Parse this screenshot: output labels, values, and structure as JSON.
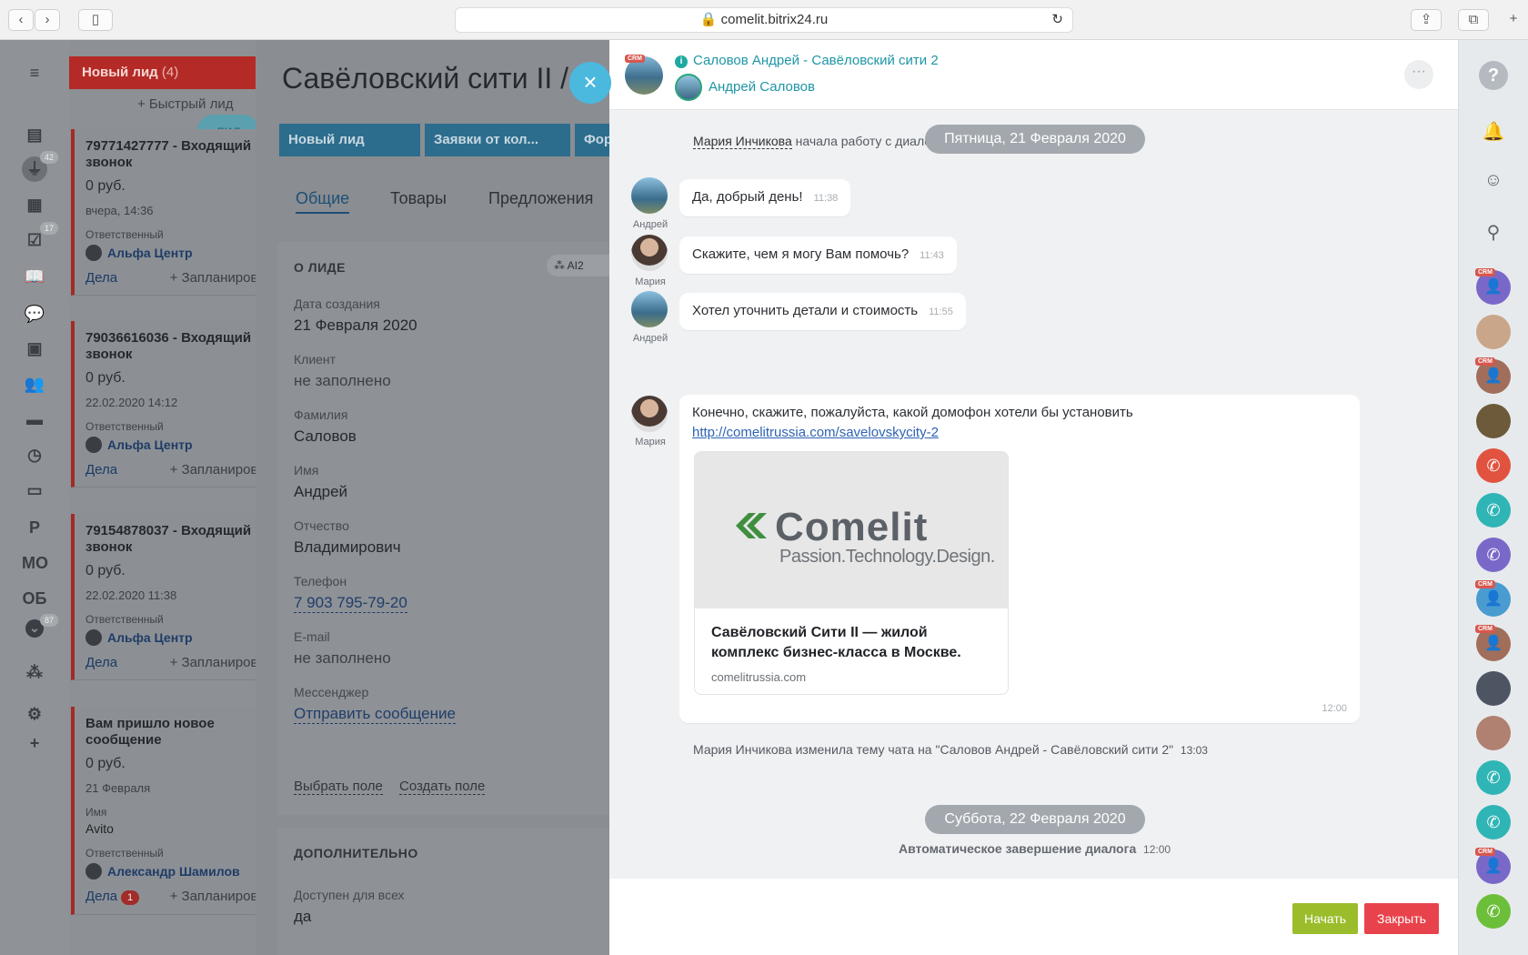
{
  "browser": {
    "url": "comelit.bitrix24.ru",
    "back": "‹",
    "forward": "›",
    "new_tab": "+"
  },
  "left_nav": {
    "items": [
      {
        "name": "menu",
        "glyph": "≡"
      },
      {
        "name": "feed",
        "glyph": "▤"
      },
      {
        "name": "crm",
        "glyph": "⏚",
        "badge": "42"
      },
      {
        "name": "calendar",
        "glyph": "▦"
      },
      {
        "name": "tasks",
        "glyph": "☑",
        "badge": "17"
      },
      {
        "name": "knowledge",
        "glyph": "📖"
      },
      {
        "name": "chat",
        "glyph": "💬"
      },
      {
        "name": "contacts",
        "glyph": "▣"
      },
      {
        "name": "employees",
        "glyph": "👥"
      },
      {
        "name": "drive",
        "glyph": "▬"
      },
      {
        "name": "time",
        "glyph": "◷"
      },
      {
        "name": "sites",
        "glyph": "▭"
      },
      {
        "name": "p",
        "glyph": "Р"
      },
      {
        "name": "mo",
        "glyph": "МО"
      },
      {
        "name": "ob",
        "glyph": "ОБ"
      },
      {
        "name": "more",
        "glyph": "⌄",
        "badge": "87"
      },
      {
        "name": "structure",
        "glyph": "⁂"
      },
      {
        "name": "settings",
        "glyph": "⚙"
      },
      {
        "name": "add",
        "glyph": "+"
      }
    ]
  },
  "kanban": {
    "column_title": "Новый лид",
    "column_count": "(4)",
    "quick_add": "+ Быстрый лид",
    "drag_pill": "лид",
    "cards": [
      {
        "title": "79771427777 - Входящий\nзвонок",
        "sum": "0 руб.",
        "date": "вчера, 14:36",
        "resp_label": "Ответственный",
        "resp": "Альфа Центр",
        "deals": "Дела",
        "plan": "+ Запланировать"
      },
      {
        "title": "79036616036 - Входящий\nзвонок",
        "sum": "0 руб.",
        "date": "22.02.2020 14:12",
        "resp_label": "Ответственный",
        "resp": "Альфа Центр",
        "deals": "Дела",
        "plan": "+ Запланировать"
      },
      {
        "title": "79154878037 - Входящий\nзвонок",
        "sum": "0 руб.",
        "date": "22.02.2020 11:38",
        "resp_label": "Ответственный",
        "resp": "Альфа Центр",
        "deals": "Дела",
        "plan": "+ Запланировать"
      },
      {
        "title": "Вам пришло новое\nсообщение",
        "sum": "0 руб.",
        "date": "21 Февраля",
        "name_label": "Имя",
        "name": "Avito",
        "resp_label": "Ответственный",
        "resp": "Александр Шамилов",
        "deals": "Дела",
        "deals_badge": "1",
        "plan": "+ Запланировать"
      }
    ]
  },
  "detail": {
    "title": "Савёловский сити II / к",
    "stages": [
      "Новый лид",
      "Заявки от кол...",
      "Фор"
    ],
    "tabs": [
      "Общие",
      "Товары",
      "Предложения"
    ],
    "about_title": "О ЛИДЕ",
    "ai_chip": "AI2",
    "fields": [
      {
        "label": "Дата создания",
        "value": "21 Февраля 2020"
      },
      {
        "label": "Клиент",
        "value": "не заполнено"
      },
      {
        "label": "Фамилия",
        "value": "Салов​ов"
      },
      {
        "label": "Имя",
        "value": "Андрей"
      },
      {
        "label": "Отчество",
        "value": "Владимирович"
      },
      {
        "label": "Телефон",
        "value": "7 903 795-79-20"
      },
      {
        "label": "E-mail",
        "value": "не заполнено"
      },
      {
        "label": "Мессенджер",
        "value": "Отправить сообщение"
      }
    ],
    "choose_field": "Выбрать поле",
    "create_field": "Создать поле",
    "extra_title": "ДОПОЛНИТЕЛЬНО",
    "extra_label": "Доступен для всех",
    "extra_value": "да",
    "close": "×"
  },
  "chat": {
    "header_title": "Салов​ов Андрей - Савёловский сити 2",
    "header_user": "Андрей Салов​ов",
    "crm": "CRM",
    "more": "···",
    "date1": "Пятница, 21 Февраля 2020",
    "sys_start_name": "Мария Инчикова",
    "sys_start_text": "начала работу с диалогом",
    "messages": [
      {
        "author": "Андрей",
        "text": "Да, добрый день!",
        "time": "11:38"
      },
      {
        "author": "Мария",
        "text": "Скажите, чем я могу Вам помочь?",
        "time": "11:43"
      },
      {
        "author": "Андрей",
        "text": "Хотел уточнить детали и стоимость",
        "time": "11:55"
      }
    ],
    "big": {
      "author": "Мария",
      "text": "Конечно, скажите, пожалуйста, какой домофон хотели бы установить",
      "link": "http://comelitrussia.com/savelovskycity-2",
      "preview_logo": "Comelit",
      "preview_tagline": "Passion.Technology.Design.",
      "preview_title": "Савёловский Сити II — жилой комплекс бизнес-класса в Москве.",
      "preview_site": "comelitrussia.com",
      "time": "12:00"
    },
    "sys_topic": "Мария Инчикова изменила тему чата на \"Салов​ов Андрей - Савёловский сити 2\"",
    "sys_topic_time": "13:03",
    "date2": "Суббота, 22 Февраля 2020",
    "auto_end": "Автоматическое завершение диалога",
    "auto_end_time": "12:00",
    "btn_start": "Начать",
    "btn_close": "Закрыть",
    "colors": {
      "start": "#9bbd2c",
      "close": "#e8434c",
      "accent": "#1e96a5"
    }
  },
  "rail": {
    "help": "?",
    "bell": "🔔",
    "chat": "☺",
    "search": "⚲",
    "items": [
      {
        "type": "crm-user",
        "color": "#7a68c9"
      },
      {
        "type": "photo",
        "color": "#c9a68a"
      },
      {
        "type": "crm-user",
        "color": "#a06e5a"
      },
      {
        "type": "photo",
        "color": "#6c5a3a"
      },
      {
        "type": "phone",
        "color": "#e1533f"
      },
      {
        "type": "phone",
        "color": "#2fb5b5"
      },
      {
        "type": "phone",
        "color": "#7a68c9"
      },
      {
        "type": "crm-user",
        "color": "#4a9bd0"
      },
      {
        "type": "crm-user",
        "color": "#a06e5a"
      },
      {
        "type": "photo",
        "color": "#4d5563"
      },
      {
        "type": "photo",
        "color": "#b08070"
      },
      {
        "type": "phone",
        "color": "#2fb5b5"
      },
      {
        "type": "phone",
        "color": "#2fb5b5"
      },
      {
        "type": "crm-user",
        "color": "#7a68c9"
      },
      {
        "type": "phone",
        "color": "#6cbf39"
      }
    ]
  }
}
